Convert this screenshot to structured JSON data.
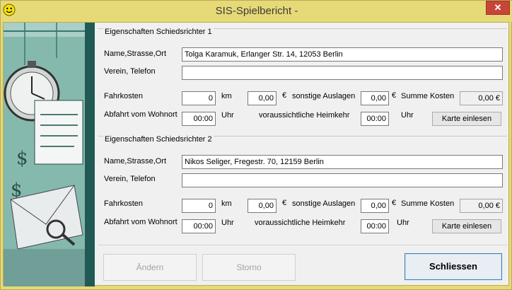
{
  "window": {
    "title": "SIS-Spielbericht -",
    "close_symbol": "✕"
  },
  "referee1": {
    "group_title": "Eigenschaften Schiedsrichter 1",
    "name_label": "Name,Strasse,Ort",
    "name_value": "Tolga Karamuk, Erlanger Str. 14, 12053 Berlin",
    "club_label": "Verein, Telefon",
    "club_value": "",
    "travel_label": "Fahrkosten",
    "travel_value": "0",
    "km_unit": "km",
    "km_value": "0,00",
    "euro_sign": "€",
    "other_label": "sonstige Auslagen",
    "other_value": "0,00",
    "euro_sign2": "€",
    "sum_label": "Summe Kosten",
    "sum_value": "0,00 €",
    "depart_label": "Abfahrt vom Wohnort",
    "depart_value": "00:00",
    "depart_unit": "Uhr",
    "return_label": "voraussichtliche Heimkehr",
    "return_value": "00:00",
    "return_unit": "Uhr",
    "card_button": "Karte einlesen"
  },
  "referee2": {
    "group_title": "Eigenschaften Schiedsrichter 2",
    "name_label": "Name,Strasse,Ort",
    "name_value": "Nikos Seliger, Fregestr. 70, 12159 Berlin",
    "club_label": "Verein, Telefon",
    "club_value": "",
    "travel_label": "Fahrkosten",
    "travel_value": "0",
    "km_unit": "km",
    "km_value": "0,00",
    "euro_sign": "€",
    "other_label": "sonstige Auslagen",
    "other_value": "0,00",
    "euro_sign2": "€",
    "sum_label": "Summe Kosten",
    "sum_value": "0,00 €",
    "depart_label": "Abfahrt vom Wohnort",
    "depart_value": "00:00",
    "depart_unit": "Uhr",
    "return_label": "voraussichtliche Heimkehr",
    "return_value": "00:00",
    "return_unit": "Uhr",
    "card_button": "Karte einlesen"
  },
  "footer": {
    "change_button": "Ändern",
    "cancel_button": "Storno",
    "close_button": "Schliessen"
  },
  "colors": {
    "title_bar": "#e6d977",
    "close_button": "#c7463a",
    "side_panel": "#2f5f58",
    "primary_border": "#3c7fb1"
  }
}
